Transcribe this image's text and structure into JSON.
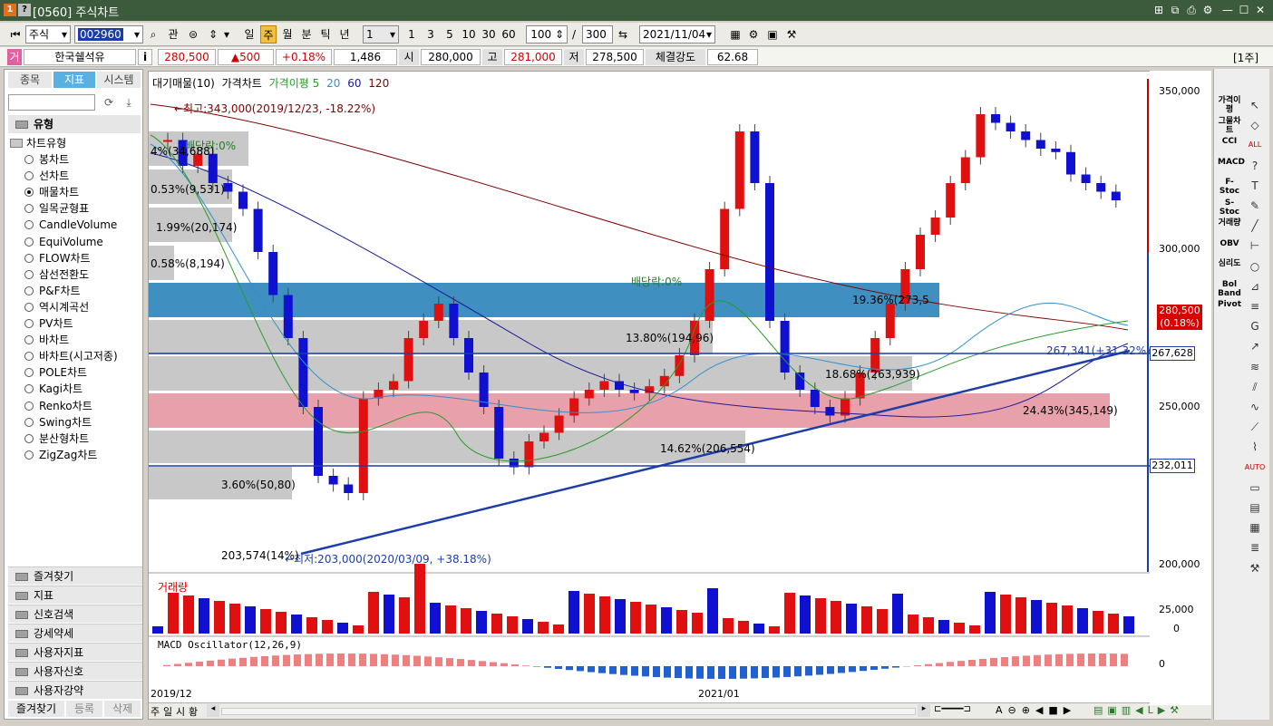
{
  "window": {
    "badge1": "1",
    "badge2": "?",
    "title": "[0560] 주식차트"
  },
  "toolbar": {
    "market": "주식",
    "code": "002960",
    "gwan": "관",
    "periods": [
      "일",
      "주",
      "월",
      "분",
      "틱",
      "년"
    ],
    "selected_period": "주",
    "interval": "1",
    "quick": [
      "1",
      "3",
      "5",
      "10",
      "30",
      "60"
    ],
    "count": "100",
    "slash": "/",
    "total": "300",
    "date": "2021/11/04"
  },
  "quote": {
    "exchange_badge": "거",
    "name": "한국쉘석유",
    "info": "i",
    "price": "280,500",
    "change": "▲500",
    "rate": "+0.18%",
    "volume": "1,486",
    "open_label": "시",
    "open": "280,000",
    "high_label": "고",
    "high": "281,000",
    "low_label": "저",
    "low": "278,500",
    "strength_label": "체결강도",
    "strength": "62.68",
    "unit": "[1주]"
  },
  "left": {
    "tabs": [
      "종목",
      "지표",
      "시스템"
    ],
    "selected_tab": "지표",
    "section": "유형",
    "group": "차트유형",
    "chart_types": [
      "봉차트",
      "선차트",
      "매물차트",
      "일목균형표",
      "CandleVolume",
      "EquiVolume",
      "FLOW차트",
      "삼선전환도",
      "P&F차트",
      "역시계곡선",
      "PV차트",
      "바차트",
      "바차트(시고저종)",
      "POLE차트",
      "Kagi차트",
      "Renko차트",
      "Swing차트",
      "분산형차트",
      "ZigZag차트"
    ],
    "selected_type": "매물차트",
    "groups": [
      "즐겨찾기",
      "지표",
      "신호검색",
      "강세약세",
      "사용자지표",
      "사용자신호",
      "사용자강약"
    ],
    "bottom_tabs": [
      "즐겨찾기",
      "등록",
      "삭제"
    ]
  },
  "chart": {
    "legend": [
      "대기매물(10)",
      "가격차트",
      "가격이평 5",
      "20",
      "60",
      "120"
    ],
    "legend_colors": [
      "#000000",
      "#000000",
      "#2a9a2a",
      "#3090d0",
      "#1a1a9a",
      "#800000"
    ],
    "high_note": "←최고:343,000(2019/12/23, -18.22%)",
    "low_note": "←최저:203,000(2020/03/09, +38.18%)",
    "dividend1": "배당락:0%",
    "dividend2": "배당락:0%",
    "profile_labels": [
      "4%(34,688)",
      "0.53%(9,531)",
      "1.99%(20,174)",
      "0.58%(8,194)",
      "19.36%(273,5",
      "13.80%(194,96)",
      "18.68%(263,939)",
      "24.43%(345,149)",
      "14.62%(206,554)",
      "3.60%(50,80)",
      "203,574(14%)"
    ],
    "trend_note": "267,341(+31.32%)",
    "y_ticks": [
      "350,000",
      "300,000",
      "250,000",
      "200,000"
    ],
    "price_tag": "280,500",
    "price_tag2": "(0.18%)",
    "hline1": "267,628",
    "hline2": "232,011",
    "volume_title": "거래량",
    "volume_ticks": [
      "25,000",
      "0"
    ],
    "macd_title": "MACD Oscillator(12,26,9)",
    "macd_tick": "0",
    "x_labels": [
      "2019/12",
      "2021/01"
    ],
    "bottom_buttons": [
      "주",
      "일",
      "시",
      "황"
    ]
  },
  "tools_left": [
    "가격이평",
    "그물차트",
    "CCI",
    "MACD",
    "F-Stoc",
    "S-Stoc",
    "거래량",
    "OBV",
    "심리도",
    "Bol Band",
    "Pivot"
  ],
  "tools_right": [
    "↖",
    "◇",
    "ALL",
    "?",
    "T",
    "✎",
    "╱",
    "⊢",
    "○",
    "⊿",
    "≡",
    "G",
    "↗",
    "≋",
    "⫽",
    "∿",
    "⟋",
    "⌇",
    "AUTO",
    "▭",
    "▤",
    "▦",
    "≣",
    "⚒"
  ],
  "chart_data": {
    "type": "candlestick",
    "y_range": [
      200000,
      350000
    ],
    "candles": []
  }
}
